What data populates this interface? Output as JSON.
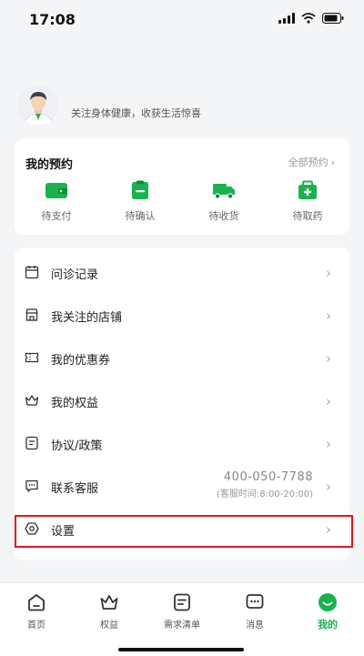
{
  "colors": {
    "accent": "#19b34e",
    "highlight": "#e3171c",
    "background": "#f4f5f7"
  },
  "status_bar": {
    "time": "17:08"
  },
  "profile": {
    "slogan": "关注身体健康，收获生活惊喜"
  },
  "appointments": {
    "title": "我的预约",
    "all_link": "全部预约",
    "items": [
      {
        "label": "待支付",
        "icon": "wallet-icon"
      },
      {
        "label": "待确认",
        "icon": "clipboard-check-icon"
      },
      {
        "label": "待收货",
        "icon": "truck-icon"
      },
      {
        "label": "待取药",
        "icon": "medicine-box-icon"
      }
    ]
  },
  "menu": {
    "items": [
      {
        "label": "问诊记录",
        "icon": "calendar-icon"
      },
      {
        "label": "我关注的店铺",
        "icon": "store-icon"
      },
      {
        "label": "我的优惠券",
        "icon": "coupon-icon"
      },
      {
        "label": "我的权益",
        "icon": "crown-icon"
      },
      {
        "label": "协议/政策",
        "icon": "document-icon"
      },
      {
        "label": "联系客服",
        "icon": "chat-icon",
        "phone": "400-050-7788",
        "hours": "(客服时间:8:00-20:00)"
      },
      {
        "label": "设置",
        "icon": "settings-icon"
      }
    ]
  },
  "tabbar": {
    "items": [
      {
        "label": "首页",
        "icon": "home-icon"
      },
      {
        "label": "权益",
        "icon": "crown-icon"
      },
      {
        "label": "需求清单",
        "icon": "list-icon"
      },
      {
        "label": "消息",
        "icon": "message-icon"
      },
      {
        "label": "我的",
        "icon": "profile-smile-icon",
        "active": true
      }
    ]
  }
}
